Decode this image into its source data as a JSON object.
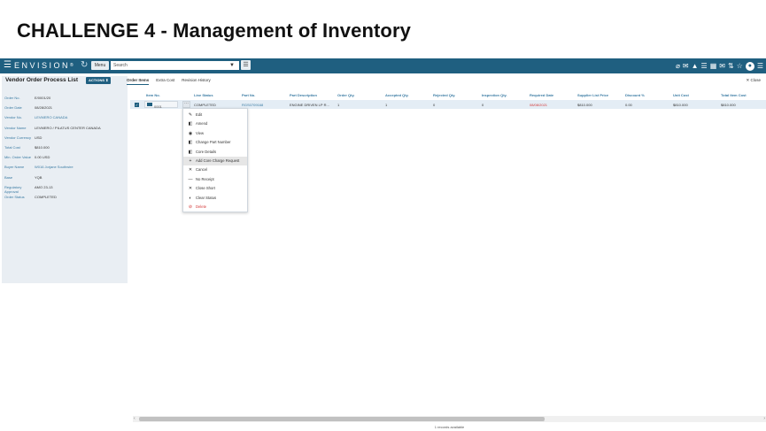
{
  "slide": {
    "title": "CHALLENGE 4 - Management of Inventory"
  },
  "topbar": {
    "brand": "ENVISION",
    "brand_mark": "®",
    "menu_label": "Menu",
    "search_placeholder": "Search",
    "icons": [
      "paperclip-icon",
      "chat-icon",
      "alert-icon",
      "list-icon",
      "calendar-icon",
      "mail-icon",
      "transfer-icon",
      "star-icon",
      "user-icon",
      "menu-icon"
    ]
  },
  "left_panel": {
    "title": "Vendor Order Process List",
    "actions_label": "ACTIONS ⬍",
    "fields": [
      {
        "label": "Order No.",
        "value": "E/0001/20",
        "link": false
      },
      {
        "label": "Order Date",
        "value": "08/28/2021",
        "link": false
      },
      {
        "label": "Vendor No.",
        "value": "LEVMERO CANADA",
        "link": true
      },
      {
        "label": "Vendor Name",
        "value": "LEVMERO / PILATUS CENTER CANADA",
        "link": false
      },
      {
        "label": "Vendor Currency",
        "value": "USD",
        "link": false
      },
      {
        "label": "Total Cost",
        "value": "$810.000",
        "link": false
      },
      {
        "label": "Min. Order Value",
        "value": "0.00 USD",
        "link": false
      },
      {
        "label": "Buyer Name",
        "value": "W016 Jorjane Southwire",
        "link": true
      },
      {
        "label": "Base",
        "value": "YQB",
        "link": false
      },
      {
        "label": "Regulatory Approval",
        "value": "AMO 23-13",
        "link": false
      },
      {
        "label": "Order Status",
        "value": "COMPLETED",
        "link": false
      }
    ]
  },
  "tabs": [
    {
      "label": "Order Items",
      "active": true
    },
    {
      "label": "Extra Cost",
      "active": false
    },
    {
      "label": "Revision History",
      "active": false
    }
  ],
  "close_label": "✕ Close",
  "table": {
    "headers": [
      "Item No.",
      "Line Status",
      "Part No.",
      "Part Description",
      "Order Qty.",
      "Accepted Qty.",
      "Rejected Qty.",
      "Inspection Qty.",
      "Required Date",
      "Supplier List Price",
      "Discount %",
      "Unit Cost",
      "Total Item Cost"
    ],
    "row": {
      "item_no": "0001",
      "line_status": "COMPLETED",
      "part_no": "RGS0709168",
      "part_description": "ENGINE DRIVEN LP R...",
      "order_qty": "1",
      "accepted_qty": "1",
      "rejected_qty": "0",
      "inspection_qty": "0",
      "required_date": "08/08/2021",
      "supplier_list_price": "$810.000",
      "discount": "0.00",
      "unit_cost": "$810.000",
      "total_item_cost": "$810.000"
    }
  },
  "context_menu": [
    {
      "icon": "✎",
      "icon_name": "edit-icon",
      "label": "Edit"
    },
    {
      "icon": "◧",
      "icon_name": "amend-icon",
      "label": "Amend"
    },
    {
      "icon": "◉",
      "icon_name": "view-icon",
      "label": "View"
    },
    {
      "icon": "◧",
      "icon_name": "change-part-icon",
      "label": "Change Part Number"
    },
    {
      "icon": "◧",
      "icon_name": "core-details-icon",
      "label": "Core Details"
    },
    {
      "icon": "+",
      "icon_name": "add-icon",
      "label": "Add Core Charge Request",
      "highlight": true
    },
    {
      "icon": "✕",
      "icon_name": "cancel-icon",
      "label": "Cancel"
    },
    {
      "icon": "—",
      "icon_name": "no-receipt-icon",
      "label": "No Receipt"
    },
    {
      "icon": "✕",
      "icon_name": "close-short-icon",
      "label": "Close Short"
    },
    {
      "icon": "◐",
      "icon_name": "clear-status-icon",
      "label": "Clear Status"
    },
    {
      "icon": "⊘",
      "icon_name": "delete-icon",
      "label": "Delete",
      "danger": true
    }
  ],
  "footer": {
    "records": "1 records available"
  }
}
